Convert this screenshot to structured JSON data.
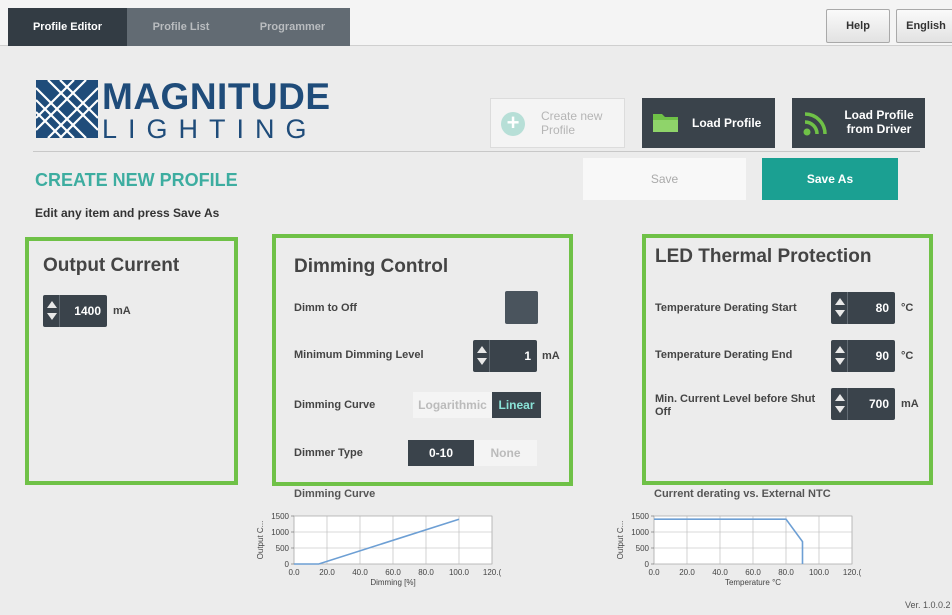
{
  "tabs": [
    {
      "label": "Profile Editor",
      "active": true
    },
    {
      "label": "Profile List",
      "active": false
    },
    {
      "label": "Programmer",
      "active": false
    }
  ],
  "top_buttons": {
    "help": "Help",
    "language": "English"
  },
  "logo": {
    "line1": "MAGNITUDE",
    "line2": "LIGHTING"
  },
  "actions": {
    "create_new": "Create new Profile",
    "load_profile": "Load Profile",
    "load_from_driver": "Load Profile from Driver"
  },
  "header": {
    "title": "CREATE NEW PROFILE",
    "subtitle": "Edit any item and press Save As",
    "save": "Save",
    "save_as": "Save As"
  },
  "output_current": {
    "title": "Output Current",
    "value": "1400",
    "unit": "mA"
  },
  "dimming": {
    "title": "Dimming Control",
    "dimm_to_off_label": "Dimm to Off",
    "min_level_label": "Minimum Dimming Level",
    "min_level_value": "1",
    "min_level_unit": "mA",
    "curve_label": "Dimming Curve",
    "curve_options": [
      "Logarithmic",
      "Linear"
    ],
    "curve_selected": "Linear",
    "dimmer_type_label": "Dimmer Type",
    "dimmer_type_options": [
      "0-10",
      "None"
    ],
    "dimmer_type_selected": "0-10"
  },
  "thermal": {
    "title": "LED Thermal Protection",
    "start_label": "Temperature Derating Start",
    "start_value": "80",
    "start_unit": "°C",
    "end_label": "Temperature Derating End",
    "end_value": "90",
    "end_unit": "°C",
    "min_current_label": "Min. Current Level before Shut Off",
    "min_current_value": "700",
    "min_current_unit": "mA"
  },
  "chart_data": [
    {
      "type": "line",
      "title": "Dimming Curve",
      "xlabel": "Dimming [%]",
      "ylabel": "Output C...",
      "xlim": [
        0,
        120
      ],
      "ylim": [
        0,
        1500
      ],
      "x_ticks": [
        "0.0",
        "20.0",
        "40.0",
        "60.0",
        "80.0",
        "100.0",
        "120.("
      ],
      "y_ticks": [
        "0",
        "500",
        "1000",
        "1500"
      ],
      "grid": true,
      "series": [
        {
          "x": [
            0,
            15,
            100
          ],
          "y": [
            0,
            0,
            1400
          ]
        }
      ],
      "line_color": "#6d9fd4"
    },
    {
      "type": "line",
      "title": "Current derating vs. External NTC",
      "xlabel": "Temperature °C",
      "ylabel": "Output C...",
      "xlim": [
        0,
        120
      ],
      "ylim": [
        0,
        1500
      ],
      "x_ticks": [
        "0.0",
        "20.0",
        "40.0",
        "60.0",
        "80.0",
        "100.0",
        "120.("
      ],
      "y_ticks": [
        "0",
        "500",
        "1000",
        "1500"
      ],
      "grid": true,
      "series": [
        {
          "x": [
            0,
            80,
            90,
            90
          ],
          "y": [
            1400,
            1400,
            700,
            0
          ]
        }
      ],
      "line_color": "#6d9fd4"
    }
  ],
  "version": "Ver. 1.0.0.2"
}
